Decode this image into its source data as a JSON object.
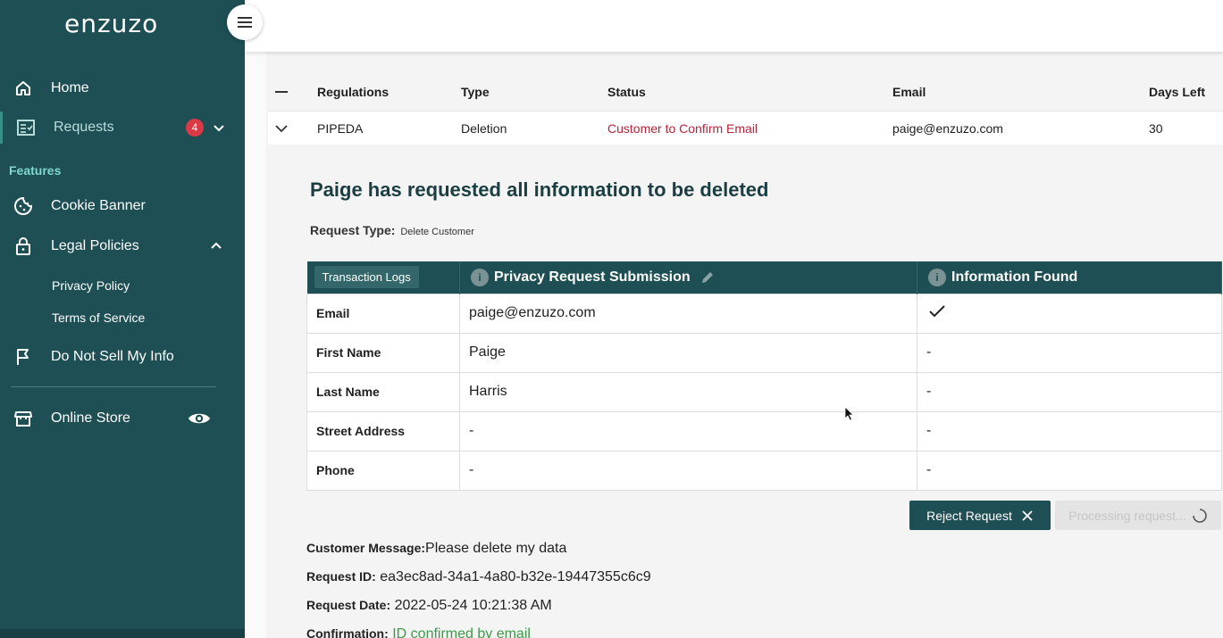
{
  "app": {
    "logo": "enzuzo"
  },
  "sidebar": {
    "items": [
      {
        "label": "Home",
        "icon": "home-icon"
      },
      {
        "label": "Requests",
        "icon": "requests-icon",
        "badge": "4"
      }
    ],
    "features_title": "Features",
    "features": [
      {
        "label": "Cookie Banner",
        "icon": "cookie-icon"
      },
      {
        "label": "Legal Policies",
        "icon": "lock-icon"
      }
    ],
    "legal_sub": [
      "Privacy Policy",
      "Terms of Service"
    ],
    "do_not_sell": {
      "label": "Do Not Sell My Info",
      "icon": "flag-icon"
    },
    "online_store": {
      "label": "Online Store",
      "icon": "store-icon"
    }
  },
  "requests_table": {
    "headers": [
      "Regulations",
      "Type",
      "Status",
      "Email",
      "Days Left"
    ],
    "row": {
      "regulation": "PIPEDA",
      "type": "Deletion",
      "status": "Customer to Confirm Email",
      "email": "paige@enzuzo.com",
      "days_left": "30"
    }
  },
  "detail": {
    "title": "Paige has requested all information to be deleted",
    "request_type_label": "Request Type:",
    "request_type_value": "Delete Customer",
    "table": {
      "col0": "Transaction Logs",
      "col1": "Privacy Request Submission",
      "col2": "Information Found",
      "rows": [
        {
          "field": "Email",
          "submitted": "paige@enzuzo.com",
          "found": "✓"
        },
        {
          "field": "First Name",
          "submitted": "Paige",
          "found": "-"
        },
        {
          "field": "Last Name",
          "submitted": "Harris",
          "found": "-"
        },
        {
          "field": "Street Address",
          "submitted": "-",
          "found": "-"
        },
        {
          "field": "Phone",
          "submitted": "-",
          "found": "-"
        }
      ]
    },
    "reject_label": "Reject Request",
    "processing_label": "Processing request...",
    "customer_message_label": "Customer Message:",
    "customer_message": "Please delete my data",
    "request_id_label": "Request ID:",
    "request_id": "ea3ec8ad-34a1-4a80-b32e-19447355c6c9",
    "request_date_label": "Request Date:",
    "request_date": "2022-05-24 10:21:38 AM",
    "confirmation_label": "Confirmation:",
    "confirmation": "ID confirmed by email"
  },
  "colors": {
    "sidebar": "#1d4f55",
    "accent_red": "#b5223a",
    "confirm_green": "#3c9a48",
    "badge": "#d93a45"
  }
}
